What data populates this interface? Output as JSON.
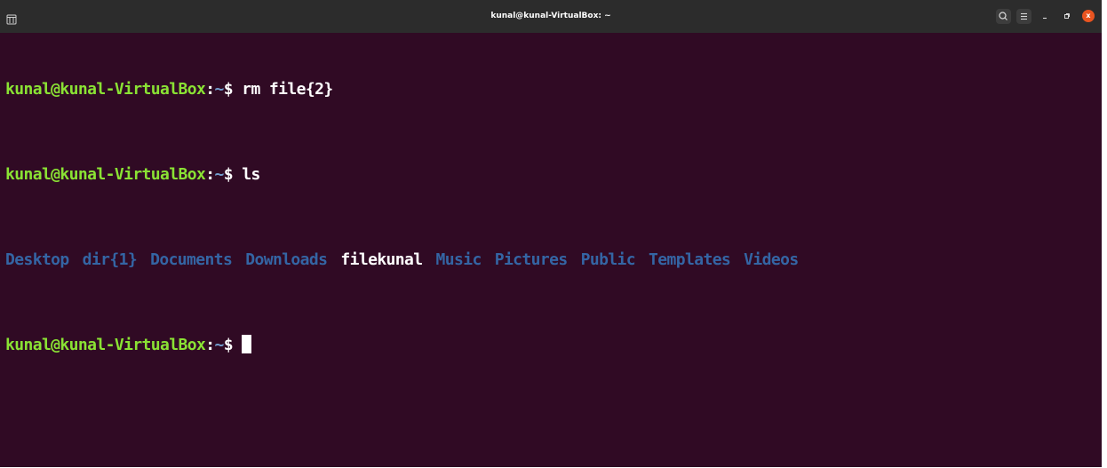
{
  "window": {
    "title": "kunal@kunal-VirtualBox: ~",
    "close_label": "x"
  },
  "prompt": {
    "user_host": "kunal@kunal-VirtualBox",
    "colon": ":",
    "path": "~",
    "symbol": "$ "
  },
  "lines": [
    {
      "command": "rm file{2}"
    },
    {
      "command": "ls"
    }
  ],
  "ls_output": [
    {
      "name": "Desktop",
      "kind": "dir"
    },
    {
      "name": "dir{1}",
      "kind": "dir"
    },
    {
      "name": "Documents",
      "kind": "dir"
    },
    {
      "name": "Downloads",
      "kind": "dir"
    },
    {
      "name": "filekunal",
      "kind": "file"
    },
    {
      "name": "Music",
      "kind": "dir"
    },
    {
      "name": "Pictures",
      "kind": "dir"
    },
    {
      "name": "Public",
      "kind": "dir"
    },
    {
      "name": "Templates",
      "kind": "dir"
    },
    {
      "name": "Videos",
      "kind": "dir"
    }
  ],
  "colors": {
    "background": "#300a24",
    "titlebar": "#2c2c2c",
    "user_host": "#8ae234",
    "directory": "#3465a4",
    "close": "#e95420"
  },
  "icons": {
    "tab": "new-tab-icon",
    "search": "search-icon",
    "menu": "hamburger-menu-icon",
    "minimize": "minimize-icon",
    "maximize": "maximize-icon",
    "close": "close-icon"
  }
}
